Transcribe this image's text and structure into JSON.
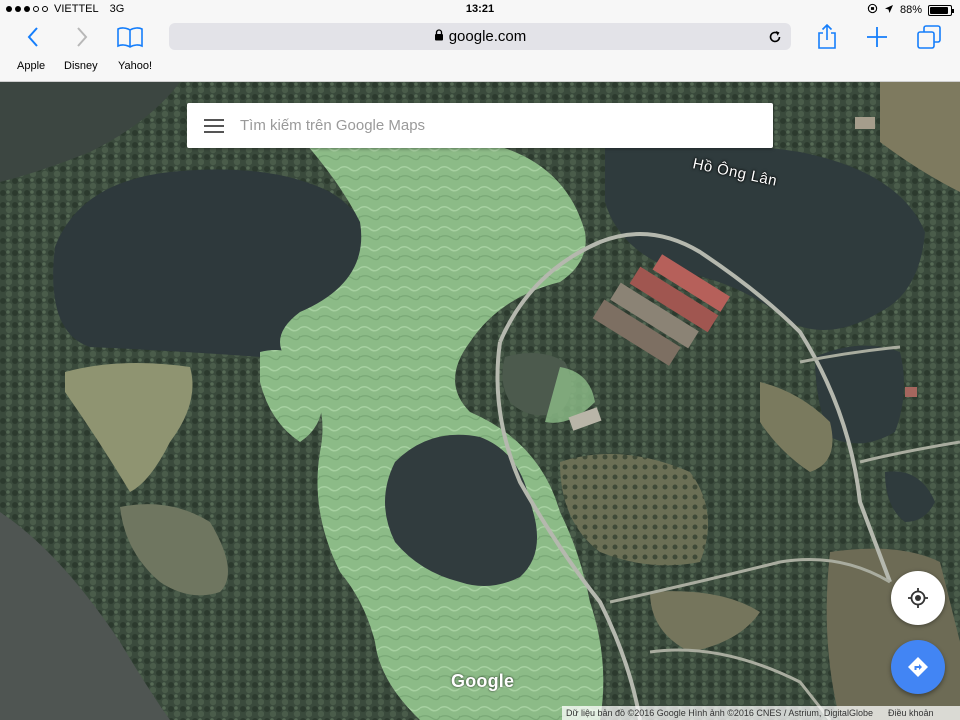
{
  "status_bar": {
    "carrier": "VIETTEL",
    "network": "3G",
    "time": "13:21",
    "battery": "88%",
    "battery_level": 0.88
  },
  "browser": {
    "url": "google.com",
    "favorites": [
      "Apple",
      "Disney",
      "Yahoo!"
    ],
    "icons": [
      "back-icon",
      "forward-icon",
      "bookmarks-icon",
      "lock-icon",
      "reload-icon",
      "share-icon",
      "new-tab-icon",
      "tabs-icon"
    ]
  },
  "map": {
    "search": {
      "placeholder": "Tìm kiếm trên Google Maps",
      "value": ""
    },
    "place_label": "Hồ Ông Lân",
    "logo": "Google",
    "attribution": "Dữ liệu bản đồ ©2016 Google Hình ảnh ©2016 CNES / Astrium, DigitalGlobe",
    "terms": "Điều khoản",
    "colors": {
      "fab_blue": "#4285f4",
      "water": "#2f3b3d",
      "algae": "#8fbf88"
    }
  }
}
